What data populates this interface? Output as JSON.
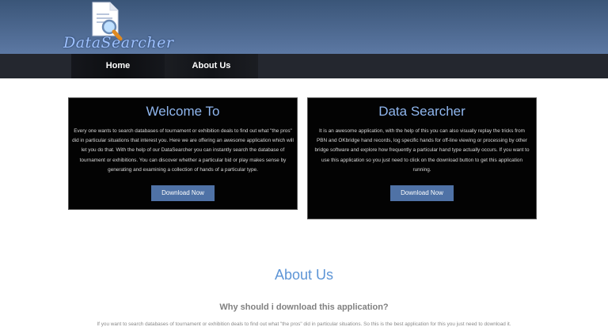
{
  "logo": {
    "text": "DataSearcher",
    "icon": "magnifier-document-icon"
  },
  "nav": {
    "items": [
      {
        "label": "Home"
      },
      {
        "label": "About Us"
      }
    ]
  },
  "cards": [
    {
      "title": "Welcome To",
      "text": "Every one wants to search databases of tournament or exhibition deals to find out what \"the pros\" did in particular situations that interest you. Here we are offering an awesome application which will let you do that. With the help of our DataSearcher you can instantly search the database of tournament or exhibitions. You can discover whether a particular bid or play makes sense by generating and examining a collection of hands of a particular type.",
      "button": "Download Now"
    },
    {
      "title": "Data Searcher",
      "text": "It is an awesome application, with the help of this you can also visually replay the tricks from PBN and OKbridge hand records, log specific hands for off-line viewing or processing by other bridge software and explore how frequently a particular hand type actually occurs. If you want to use this application so you just need to click on the download button to get this application running.",
      "button": "Download Now"
    }
  ],
  "about": {
    "title": "About Us",
    "subtitle": "Why should i download this application?",
    "text": "If you want to search databases of tournament or exhibition deals to find out what \"the pros\" did in particular situations. So this is the best application for this you just need to download it."
  },
  "colors": {
    "header_top": "#3a5578",
    "header_bottom": "#5c78a3",
    "navbar": "#24272f",
    "card_bg": "#030303",
    "accent": "#5d95d6",
    "button": "#4f72a6"
  }
}
